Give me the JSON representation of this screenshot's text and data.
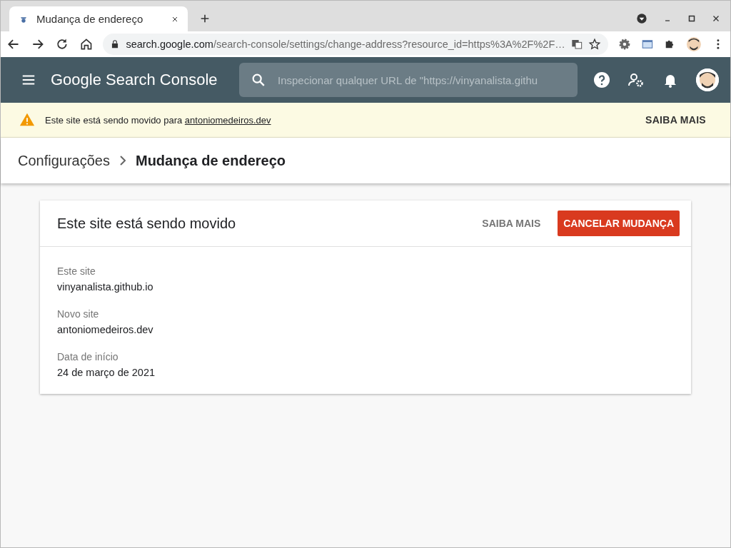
{
  "browser": {
    "tab": {
      "title": "Mudança de endereço"
    },
    "address": {
      "host": "search.google.com",
      "path": "/search-console/settings/change-address?resource_id=https%3A%2F%2F…"
    }
  },
  "header": {
    "logo": "Google Search Console",
    "search": {
      "placeholder": "Inspecionar qualquer URL de \"https://vinyanalista.githu"
    }
  },
  "banner": {
    "text": "Este site está sendo movido para ",
    "link": "antoniomedeiros.dev",
    "action": "SAIBA MAIS"
  },
  "breadcrumb": [
    {
      "label": "Configurações",
      "selected": false
    },
    {
      "label": "Mudança de endereço",
      "selected": true
    }
  ],
  "card": {
    "title": "Este site está sendo movido",
    "buttons": [
      {
        "label": "SAIBA MAIS",
        "kind": "text"
      },
      {
        "label": "CANCELAR MUDANÇA",
        "kind": "primary"
      }
    ],
    "fields": [
      {
        "label": "Este site",
        "value": "vinyanalista.github.io"
      },
      {
        "label": "Novo site",
        "value": "antoniomedeiros.dev"
      },
      {
        "label": "Data de início",
        "value": "24 de março de 2021"
      }
    ]
  }
}
